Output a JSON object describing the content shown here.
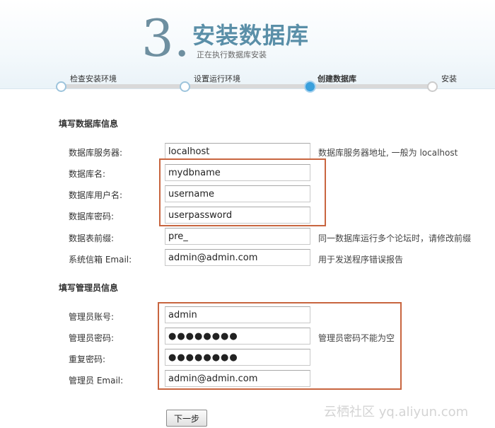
{
  "header": {
    "step_number": "3.",
    "title": "安装数据库",
    "subtitle": "正在执行数据库安装"
  },
  "steps": [
    {
      "label": "检查安装环境",
      "state": "done"
    },
    {
      "label": "设置运行环境",
      "state": "done"
    },
    {
      "label": "创建数据库",
      "state": "active"
    },
    {
      "label": "安装",
      "state": "pending"
    }
  ],
  "db_section": {
    "title": "填写数据库信息",
    "fields": [
      {
        "label": "数据库服务器:",
        "value": "localhost",
        "hint": "数据库服务器地址, 一般为 localhost"
      },
      {
        "label": "数据库名:",
        "value": "mydbname",
        "hint": ""
      },
      {
        "label": "数据库用户名:",
        "value": "username",
        "hint": ""
      },
      {
        "label": "数据库密码:",
        "value": "userpassword",
        "hint": ""
      },
      {
        "label": "数据表前缀:",
        "value": "pre_",
        "hint": "同一数据库运行多个论坛时，请修改前缀"
      },
      {
        "label": "系统信箱 Email:",
        "value": "admin@admin.com",
        "hint": "用于发送程序错误报告"
      }
    ]
  },
  "admin_section": {
    "title": "填写管理员信息",
    "fields": [
      {
        "label": "管理员账号:",
        "value": "admin",
        "hint": ""
      },
      {
        "label": "管理员密码:",
        "value": "●●●●●●●●",
        "hint": "管理员密码不能为空"
      },
      {
        "label": "重复密码:",
        "value": "●●●●●●●●",
        "hint": ""
      },
      {
        "label": "管理员 Email:",
        "value": "admin@admin.com",
        "hint": ""
      }
    ]
  },
  "next_button_label": "下一步",
  "watermark": "云栖社区 yq.aliyun.com",
  "colors": {
    "accent": "#5a8fa8",
    "highlight_box": "#c8653f",
    "active_step": "#3aa0dc"
  }
}
